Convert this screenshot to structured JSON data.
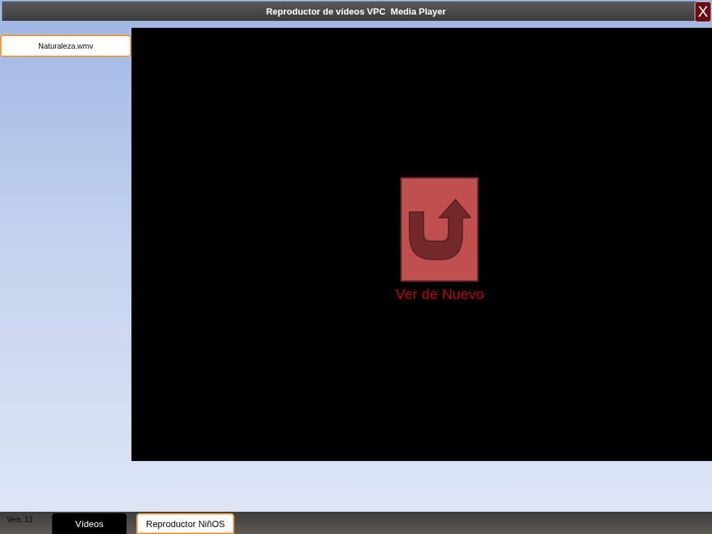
{
  "window": {
    "title": "Reproductor de vídeos VPC  Media Player",
    "close": "X"
  },
  "playlist": [
    {
      "label": "Naturaleza.wmv"
    }
  ],
  "player": {
    "replay_label": "Ver de Nuevo"
  },
  "status_bar": {
    "version": "Vem. 13",
    "tabs": [
      {
        "label": "Vídeos",
        "selected": true
      },
      {
        "label": "Reproductor NiñOS",
        "selected": false
      }
    ]
  }
}
